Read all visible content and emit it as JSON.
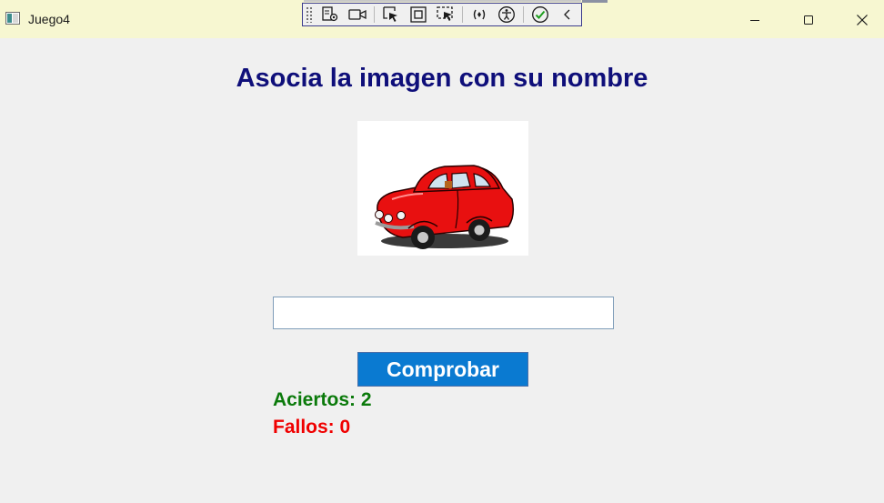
{
  "window": {
    "title": "Juego4",
    "controls": [
      "minimize",
      "maximize",
      "close"
    ]
  },
  "debug_toolbar": {
    "icons": [
      "live-visual-tree-icon",
      "record-icon",
      "select-element-icon",
      "display-layout-adorners-icon",
      "track-focused-element-icon",
      "hot-reload-icon",
      "accessibility-icon",
      "binding-check-icon",
      "collapse-icon"
    ]
  },
  "game": {
    "title": "Asocia la imagen con su nombre",
    "image_icon": "red-car-image",
    "answer_value": "",
    "check_button_label": "Comprobar",
    "hits_text": "Aciertos: 2",
    "fails_text": "Fallos: 0"
  },
  "colors": {
    "titlebar_bg": "#f7f7d1",
    "title_text": "#0f0f7a",
    "button_bg": "#0a7ad1",
    "hits_text": "#0b7a0b",
    "fails_text": "#f00000",
    "window_bg": "#f0f0f0"
  }
}
